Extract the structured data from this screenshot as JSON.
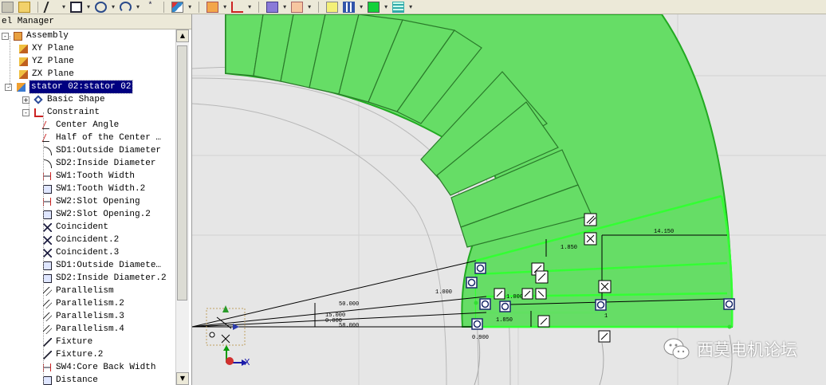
{
  "panel": {
    "title": "el Manager"
  },
  "tree": {
    "items": [
      {
        "label": "Assembly",
        "icon": "assembly-icon"
      },
      {
        "label": "XY Plane",
        "icon": "plane-icon"
      },
      {
        "label": "YZ Plane",
        "icon": "plane-icon"
      },
      {
        "label": "ZX Plane",
        "icon": "plane-icon"
      },
      {
        "label": "stator 02:stator 02",
        "icon": "part-icon"
      },
      {
        "label": "Basic Shape",
        "icon": "shape-icon"
      },
      {
        "label": "Constraint",
        "icon": "constraint-icon"
      },
      {
        "label": "Center Angle",
        "icon": "angle-icon"
      },
      {
        "label": "Half of the Center …",
        "icon": "angle-icon"
      },
      {
        "label": "SD1:Outside Diameter",
        "icon": "diameter-icon"
      },
      {
        "label": "SD2:Inside Diameter",
        "icon": "diameter-icon"
      },
      {
        "label": "SW1:Tooth Width",
        "icon": "width-icon"
      },
      {
        "label": "SW1:Tooth Width.2",
        "icon": "width2-icon"
      },
      {
        "label": "SW2:Slot Opening",
        "icon": "width-icon"
      },
      {
        "label": "SW2:Slot Opening.2",
        "icon": "width2-icon"
      },
      {
        "label": "Coincident",
        "icon": "coincident-icon"
      },
      {
        "label": "Coincident.2",
        "icon": "coincident-icon"
      },
      {
        "label": "Coincident.3",
        "icon": "coincident-icon"
      },
      {
        "label": "SD1:Outside Diamete…",
        "icon": "diameter2-icon"
      },
      {
        "label": "SD2:Inside Diameter.2",
        "icon": "diameter2-icon"
      },
      {
        "label": "Parallelism",
        "icon": "parallel-icon"
      },
      {
        "label": "Parallelism.2",
        "icon": "parallel-icon"
      },
      {
        "label": "Parallelism.3",
        "icon": "parallel-icon"
      },
      {
        "label": "Parallelism.4",
        "icon": "parallel-icon"
      },
      {
        "label": "Fixture",
        "icon": "fixture-icon"
      },
      {
        "label": "Fixture.2",
        "icon": "fixture-icon"
      },
      {
        "label": "SW4:Core Back Width",
        "icon": "width-icon"
      },
      {
        "label": "Distance",
        "icon": "distance-icon"
      }
    ]
  },
  "sketch": {
    "dimensions": {
      "d_14150": "14.150",
      "d_1850_top": "1.850",
      "d_1000_left": "1.000",
      "d_1000_right": "1.000",
      "d_1850_bottom": "1.850",
      "d_50000": "50.000",
      "d_15000": "15.000",
      "d_0000": "0.000",
      "d_58000": "58.000",
      "d_0900": "0.900",
      "d_1_small": "1"
    },
    "axis_label": "X"
  },
  "watermark": {
    "text": "西莫电机论坛"
  },
  "colors": {
    "stator_fill": "#66dd66",
    "stator_edge": "#22aa22",
    "highlight": "#33ff33",
    "selection": "#000080"
  }
}
